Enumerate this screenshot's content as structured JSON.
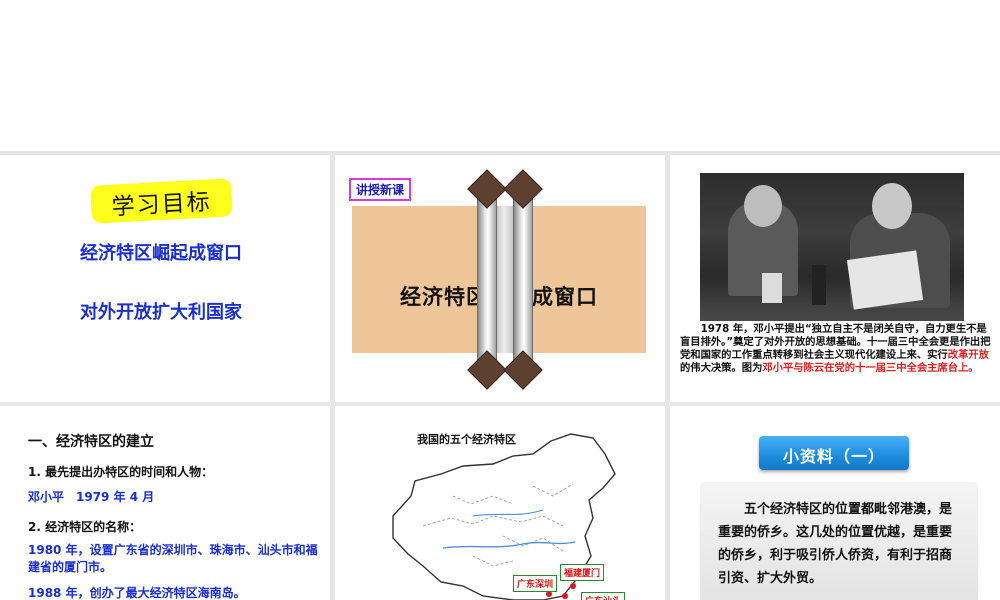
{
  "slide1": {
    "badge": "学习目标",
    "goal1": "经济特区崛起成窗口",
    "goal2": "对外开放扩大利国家"
  },
  "slide2": {
    "tag": "讲授新课",
    "scroll_title": "经济特区崛起成窗口"
  },
  "slide3": {
    "caption_part1": "1978 年，邓小平提出“独立自主不是闭关自守，自力更生不是盲目排外。”奠定了对外开放的思想基础。十一届三中全会更是作出把党和国家的工作重点转移到社会主义现代化建设上来、实行",
    "caption_red1": "改革开放",
    "caption_part2": "的伟大决策。图为",
    "caption_red2": "邓小平与陈云在党的十一届三中全会主席台上。"
  },
  "slide4": {
    "heading": "一、经济特区的建立",
    "q1": "1. 最先提出办特区的时间和人物：",
    "a1": "邓小平　1979 年 4 月",
    "q2": "2. 经济特区的名称：",
    "a2": "1980 年，设置广东省的深圳市、珠海市、汕头市和福建省的厦门市。",
    "a3": "1988 年，创办了最大经济特区海南岛。"
  },
  "slide5": {
    "title": "我国的五个经济特区",
    "labels": [
      "广东深圳",
      "福建厦门",
      "广东汕头"
    ]
  },
  "slide6": {
    "button": "小资料（一）",
    "text": "五个经济特区的位置都毗邻港澳，是重要的侨乡。这几处的位置优越，是重要的侨乡，利于吸引侨人侨资，有利于招商引资、扩大外贸。"
  },
  "colors": {
    "blue_text": "#1a2fd1",
    "red_text": "#e02020",
    "badge_yellow": "#ffff1e",
    "scroll_paper": "#efc69a",
    "info_button": "#1f8fdf"
  }
}
